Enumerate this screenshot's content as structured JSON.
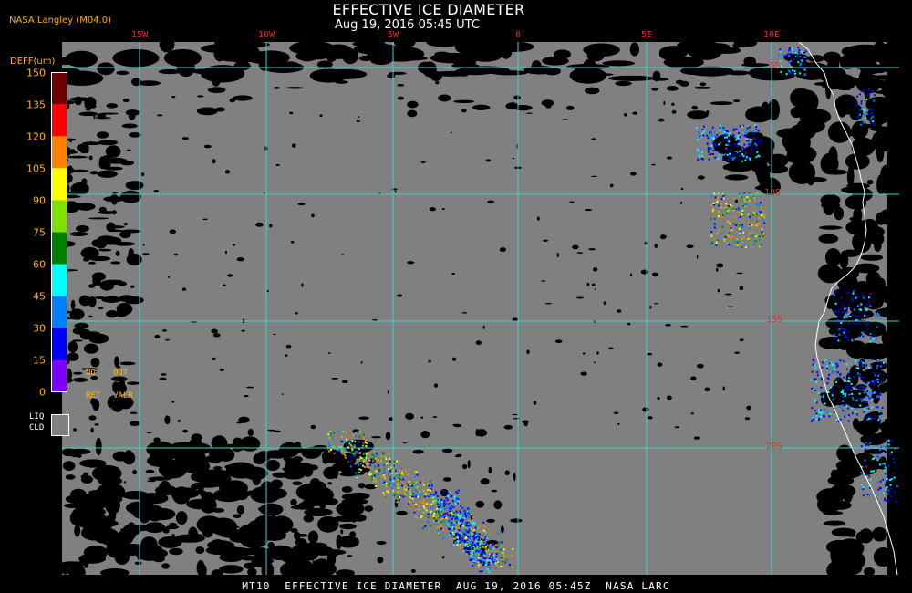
{
  "title": "EFFECTIVE ICE DIAMETER",
  "subtitle": "Aug 19, 2016 05:45 UTC",
  "credit": "NASA Langley (M04.0)",
  "footer": "MT10  EFFECTIVE ICE DIAMETER  AUG 19, 2016 05:45Z  NASA LARC",
  "map": {
    "lon_labels": [
      "15W",
      "10W",
      "5W",
      "0",
      "5E",
      "10E"
    ],
    "lat_labels": [
      "5S",
      "10S",
      "15S",
      "20S"
    ],
    "grid_color": "#3fd0d0",
    "label_color": "#e03030",
    "cloud_color": "#808080",
    "clear_color": "#000000",
    "coast_color": "#ffffff"
  },
  "legend": {
    "title": "DEFF(um)",
    "ticks": [
      "150",
      "135",
      "120",
      "105",
      "90",
      "75",
      "60",
      "45",
      "30",
      "15",
      "0"
    ],
    "colors": [
      "#6e0000",
      "#ff0000",
      "#ff8000",
      "#ffff00",
      "#80e000",
      "#008000",
      "#00ffff",
      "#0080ff",
      "#0000ff",
      "#8000ff"
    ],
    "no_ret": [
      "NO",
      "RET"
    ],
    "out_valr": [
      "OUT",
      "VALR"
    ],
    "liq_cld": [
      "LIQ",
      "CLD"
    ]
  }
}
